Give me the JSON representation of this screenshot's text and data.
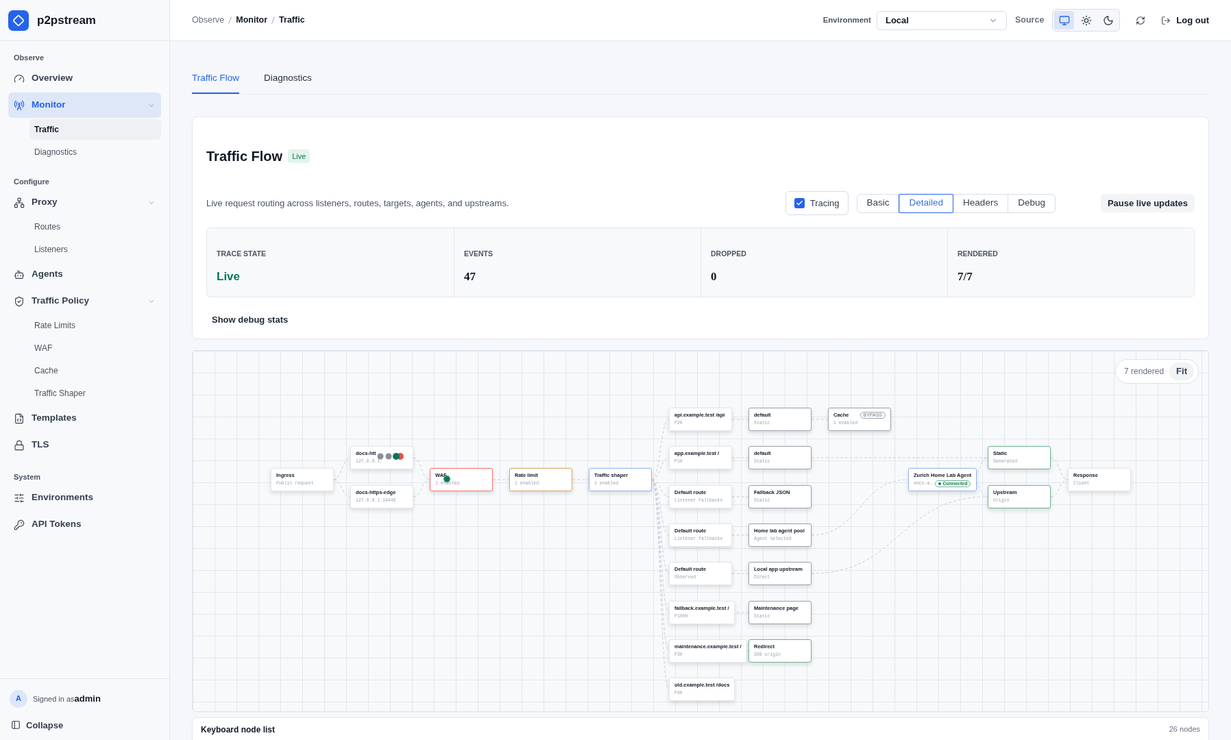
{
  "sidebar": {
    "brand": "p2pstream",
    "sections": [
      {
        "title": "Observe",
        "items": [
          {
            "label": "Overview",
            "selected": false
          },
          {
            "label": "Monitor",
            "selected": true,
            "expanded": true,
            "children": [
              {
                "label": "Traffic",
                "selected": true
              },
              {
                "label": "Diagnostics",
                "selected": false
              }
            ]
          }
        ]
      },
      {
        "title": "Configure",
        "items": [
          {
            "label": "Proxy",
            "selected": false,
            "expanded": true,
            "children": [
              {
                "label": "Routes",
                "selected": false
              },
              {
                "label": "Listeners",
                "selected": false
              }
            ]
          },
          {
            "label": "Agents",
            "selected": false
          },
          {
            "label": "Traffic Policy",
            "selected": false,
            "expanded": true,
            "children": [
              {
                "label": "Rate Limits",
                "selected": false
              },
              {
                "label": "WAF",
                "selected": false
              },
              {
                "label": "Cache",
                "selected": false
              },
              {
                "label": "Traffic Shaper",
                "selected": false
              }
            ]
          },
          {
            "label": "Templates",
            "selected": false
          },
          {
            "label": "TLS",
            "selected": false
          }
        ]
      },
      {
        "title": "System",
        "items": [
          {
            "label": "Environments",
            "selected": false
          },
          {
            "label": "API Tokens",
            "selected": false
          }
        ]
      }
    ],
    "user": {
      "initial": "A",
      "text": "Signed in as**admin**"
    },
    "collapse": "Collapse"
  },
  "header": {
    "breadcrumb": [
      "Observe",
      "Monitor",
      "Traffic"
    ],
    "environment_label": "Environment",
    "environment": "Local",
    "source_label": "Source",
    "themes": [
      {
        "selected": true
      },
      {
        "selected": false
      },
      {
        "selected": false
      }
    ],
    "logout": "Log out"
  },
  "tabs": [
    {
      "label": "Traffic Flow",
      "selected": true
    },
    {
      "label": "Diagnostics",
      "selected": false
    }
  ],
  "card": {
    "title": "Traffic Flow",
    "badge": "Live",
    "description": "Live request routing across listeners, routes, targets, agents, and upstreams.",
    "tracing": {
      "label": "Tracing",
      "checked": true
    },
    "modes": [
      {
        "label": "Basic",
        "selected": false
      },
      {
        "label": "Detailed",
        "selected": true
      },
      {
        "label": "Headers",
        "selected": false
      },
      {
        "label": "Debug",
        "selected": false
      }
    ],
    "pause": "Pause live updates",
    "stats": [
      {
        "label": "TRACE STATE",
        "value": "Live",
        "kind": "status"
      },
      {
        "label": "EVENTS",
        "value": "47",
        "kind": "number"
      },
      {
        "label": "DROPPED",
        "value": "0",
        "kind": "number"
      },
      {
        "label": "RENDERED",
        "value": "7/7",
        "kind": "number"
      }
    ],
    "debug": "Show debug stats"
  },
  "canvas": {
    "rendered": "7 rendered",
    "fit": "Fit",
    "nodes": [
      {
        "title": "Ingress",
        "sub": "Public request",
        "color": "#e5e7eb"
      },
      {
        "title": "docs-htt",
        "sub": "127.0.0.1:",
        "color": "#e5e7eb",
        "tracing": true
      },
      {
        "title": "docs-https-edge",
        "sub": "127.0.0.1:19446",
        "color": "#e5e7eb"
      },
      {
        "title": "WAF",
        "sub": "1 enabled",
        "color": "#f87171",
        "tracing": true
      },
      {
        "title": "Rate limit",
        "sub": "1 enabled",
        "color": "#d6a75c"
      },
      {
        "title": "Traffic shaper",
        "sub": "1 enabled",
        "color": "#93b4f5"
      },
      {
        "title": "api.example.test /api",
        "sub": "P20",
        "color": "#e5e7eb"
      },
      {
        "title": "app.example.test /",
        "sub": "P10",
        "color": "#e5e7eb"
      },
      {
        "title": "Default route",
        "sub": "Listener fallbacks",
        "color": "#e5e7eb"
      },
      {
        "title": "Default route",
        "sub": "Listener fallbacks",
        "color": "#e5e7eb"
      },
      {
        "title": "Default route",
        "sub": "Observed",
        "color": "#e5e7eb"
      },
      {
        "title": "fallback.example.test /",
        "sub": "P1000",
        "color": "#e5e7eb"
      },
      {
        "title": "maintenance.example.test /",
        "sub": "P30",
        "color": "#e5e7eb"
      },
      {
        "title": "old.example.test /docs",
        "sub": "P40",
        "color": "#e5e7eb"
      },
      {
        "title": "default",
        "sub": "Static",
        "color": "#9ca3af"
      },
      {
        "title": "default",
        "sub": "Static",
        "color": "#9ca3af"
      },
      {
        "title": "Fallback JSON",
        "sub": "Static",
        "color": "#9ca3af"
      },
      {
        "title": "Home lab agent pool",
        "sub": "Agent selected",
        "color": "#9ca3af"
      },
      {
        "title": "Local app upstream",
        "sub": "Direct",
        "color": "#9ca3af"
      },
      {
        "title": "Maintenance page",
        "sub": "Static",
        "color": "#9ca3af"
      },
      {
        "title": "Redirect",
        "sub": "308 origin",
        "color": "#6fb391"
      },
      {
        "title": "Cache",
        "sub": "1 enabled",
        "color": "#9ca3af",
        "badge": "BYPASS"
      },
      {
        "title": "Zurich Home Lab Agent",
        "sub": "docs-a…",
        "color": "#93b4f5",
        "status": "Connected"
      },
      {
        "title": "Static",
        "sub": "Generated",
        "color": "#6fb391"
      },
      {
        "title": "Upstream",
        "sub": "Origin",
        "color": "#6fb391"
      },
      {
        "title": "Response",
        "sub": "Client",
        "color": "#e5e7eb"
      }
    ]
  },
  "node_list": {
    "title": "Keyboard node list",
    "count": "26 nodes"
  }
}
